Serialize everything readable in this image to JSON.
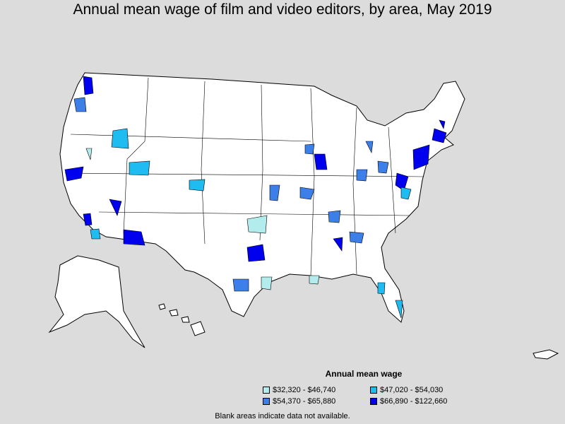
{
  "title": "Annual mean wage of film and video editors, by area, May 2019",
  "legend": {
    "title": "Annual mean wage",
    "items": [
      {
        "label": "$32,320 - $46,740",
        "color": "#b3ecec"
      },
      {
        "label": "$47,020 - $54,030",
        "color": "#1ebcf0"
      },
      {
        "label": "$54,370 - $65,880",
        "color": "#3d7fe8"
      },
      {
        "label": "$66,890 - $122,660",
        "color": "#0000ee"
      }
    ]
  },
  "note": "Blank areas indicate data not available.",
  "colors": {
    "background": "#dcdcdc",
    "land": "#ffffff",
    "border": "#000000"
  }
}
